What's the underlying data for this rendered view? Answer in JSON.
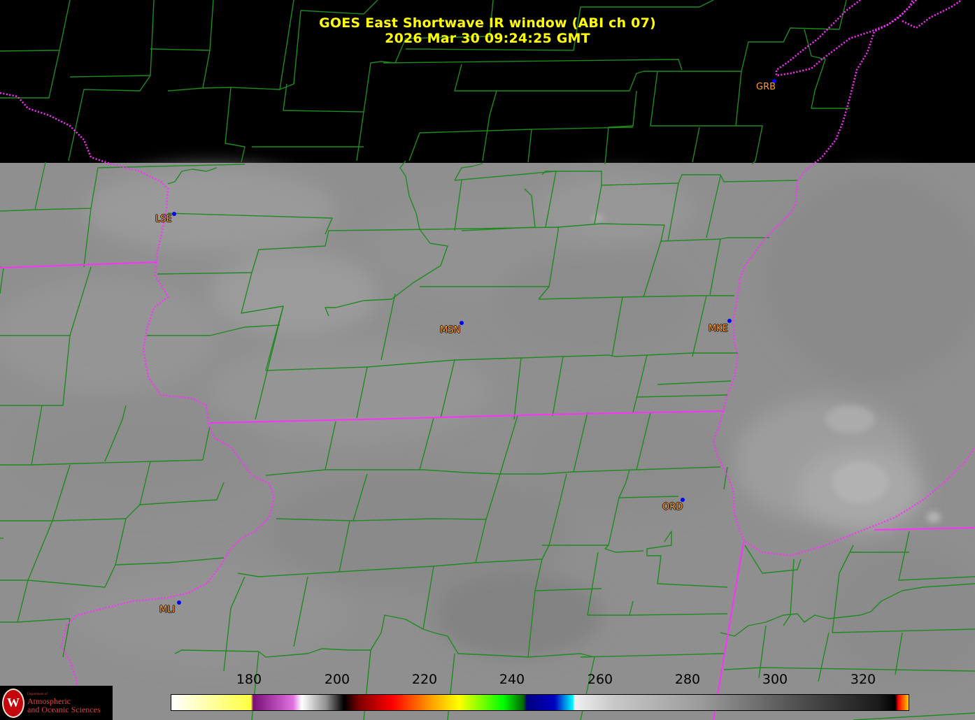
{
  "map": {
    "title_line1": "GOES East Shortwave IR window (ABI ch 07)",
    "title_line2": "2026 Mar 30  09:24:25 GMT",
    "colors": {
      "background": "#000000",
      "county_lines": "#1f8a1f",
      "state_lines": "#ff30ff",
      "coastline": "#ff30ff",
      "title": "#ffff00",
      "station_label": "#ff9a30",
      "station_dot": "#0000ff"
    },
    "stations": [
      {
        "id": "GRB",
        "label": "GRB"
      },
      {
        "id": "LSE",
        "label": "LSE"
      },
      {
        "id": "MSN",
        "label": "MSN"
      },
      {
        "id": "MKE",
        "label": "MKE"
      },
      {
        "id": "ORD",
        "label": "ORD"
      },
      {
        "id": "MLI",
        "label": "MLI"
      }
    ]
  },
  "colorbar": {
    "ticks": [
      "180",
      "200",
      "220",
      "240",
      "260",
      "280",
      "300",
      "320"
    ]
  },
  "logo": {
    "initial": "W",
    "dept": "Department of",
    "line1": "Atmospheric",
    "line2": "and Oceanic Sciences"
  }
}
